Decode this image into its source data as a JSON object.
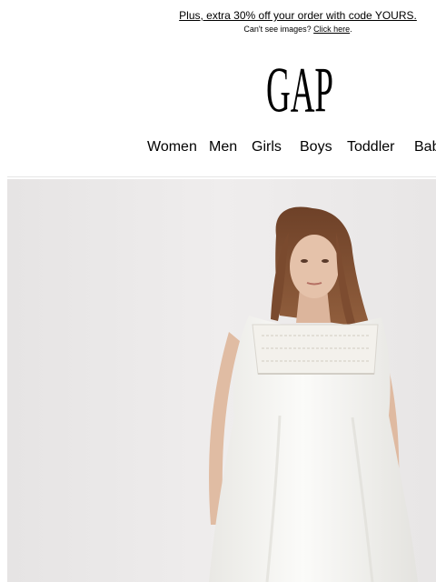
{
  "header": {
    "promo_text": "Plus, extra 30% off your order with code YOURS.",
    "images_note": "Can't see images?",
    "images_link": "Click here",
    "images_note_end": ".",
    "logo_text": "GAP"
  },
  "nav": {
    "items": [
      "Women",
      "Men",
      "Girls",
      "Boys",
      "Toddler",
      "Bab"
    ]
  },
  "hero": {
    "image_subject": "woman-in-white-sleeveless-lace-yoke-dress",
    "background_color": "#eceaea",
    "dress_color": "#fafaf8",
    "hair_color": "#8a5636"
  }
}
